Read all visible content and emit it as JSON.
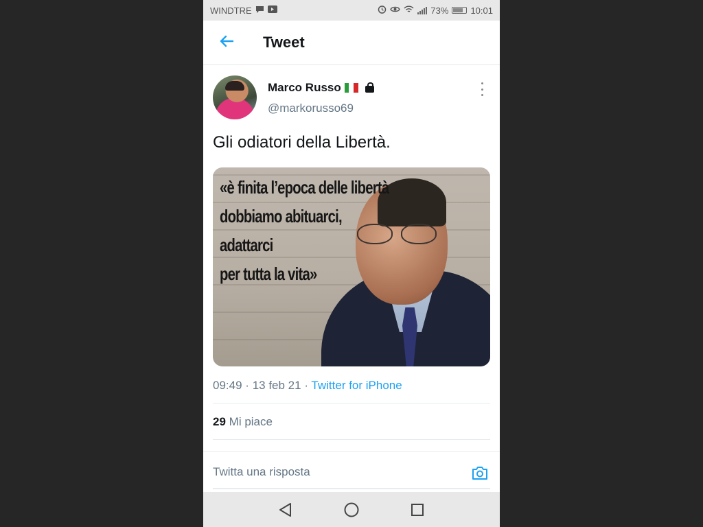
{
  "status_bar": {
    "carrier": "WINDTRE",
    "battery": "73%",
    "time": "10:01"
  },
  "header": {
    "title": "Tweet"
  },
  "tweet": {
    "user_name": "Marco Russo",
    "handle": "@markorusso69",
    "text": "Gli odiatori della Libertà.",
    "image_quote_lines": [
      "«è finita l’epoca delle libertà",
      "dobbiamo abituarci,",
      "adattarci",
      "per tutta la vita»"
    ],
    "time": "09:49",
    "separator": "·",
    "date": "13 feb 21",
    "source": "Twitter for iPhone",
    "likes_count": "29",
    "likes_label": "Mi piace"
  },
  "reply": {
    "placeholder": "Twitta una risposta"
  },
  "colors": {
    "accent": "#1da1f2",
    "text": "#14171a",
    "muted": "#657786"
  },
  "icons": {
    "back": "arrow-left-icon",
    "more": "more-vertical-icon",
    "lock": "lock-icon",
    "camera": "camera-icon",
    "nav_back": "triangle-back-icon",
    "nav_home": "circle-home-icon",
    "nav_recent": "square-recent-icon"
  }
}
